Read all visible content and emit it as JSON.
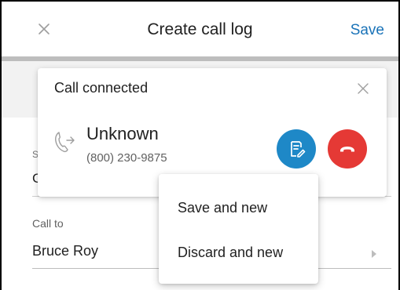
{
  "header": {
    "title": "Create call log",
    "save_label": "Save"
  },
  "form": {
    "partial_label": "S",
    "partial_value": "C",
    "call_to": {
      "label": "Call to",
      "value": "Bruce Roy"
    }
  },
  "call_card": {
    "title": "Call connected",
    "caller_name": "Unknown",
    "caller_phone": "(800) 230-9875",
    "icons": {
      "close": "close-icon",
      "call": "incoming-call-icon",
      "note": "edit-note-icon",
      "hangup": "hang-up-icon"
    }
  },
  "menu": {
    "items": [
      {
        "label": "Save and new"
      },
      {
        "label": "Discard and new"
      }
    ]
  },
  "colors": {
    "accent": "#1a73b8",
    "note_button": "#1e88c7",
    "hangup_button": "#e53935"
  }
}
